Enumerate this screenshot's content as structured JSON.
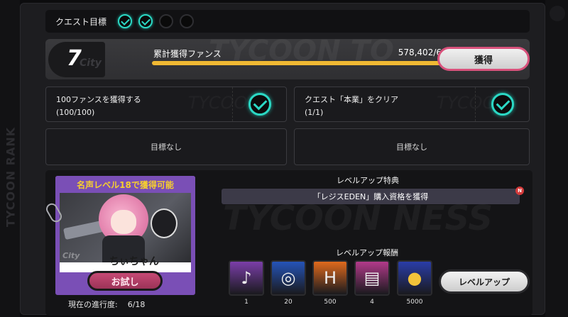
{
  "side_tab": {
    "label": "TYCOON RANK"
  },
  "quest_header": {
    "label": "クエスト目標",
    "dots": [
      true,
      true,
      false,
      false
    ]
  },
  "rank": {
    "level": "7",
    "fans_label": "累計獲得ファンス",
    "fans_value": "578,402/600,600",
    "progress_fraction": 0.963,
    "obtain_label": "獲得"
  },
  "missions": [
    {
      "title": "100ファンスを獲得する",
      "count": "(100/100)",
      "done": true
    },
    {
      "title": "クエスト「本業」をクリア",
      "count": "(1/1)",
      "done": true
    }
  ],
  "empty_slots": [
    "目標なし",
    "目標なし"
  ],
  "character_card": {
    "header": "名声レベル18で獲得可能",
    "name": "ちぃちゃん",
    "trial_label": "お試し",
    "progress_label": "現在の進行度:",
    "progress_value": "6/18"
  },
  "perk": {
    "title": "レベルアップ特典",
    "text": "「レジスEDEN」購入資格を獲得",
    "badge": "N"
  },
  "rewards": {
    "title": "レベルアップ報酬",
    "items": [
      {
        "icon": "music-player-icon",
        "qty": "1",
        "color": "#7b3ea8",
        "glyph": "♪"
      },
      {
        "icon": "blue-vinyl-icon",
        "qty": "20",
        "color": "#2554b8",
        "glyph": "◎"
      },
      {
        "icon": "hunter-badge-icon",
        "qty": "500",
        "color": "#e06a1d",
        "glyph": "H"
      },
      {
        "icon": "dark-card-icon",
        "qty": "4",
        "color": "#b23a8a",
        "glyph": "▤"
      },
      {
        "icon": "gold-coin-icon",
        "qty": "5000",
        "color": "#2a3da8",
        "glyph": "●"
      }
    ]
  },
  "level_up_label": "レベルアップ"
}
